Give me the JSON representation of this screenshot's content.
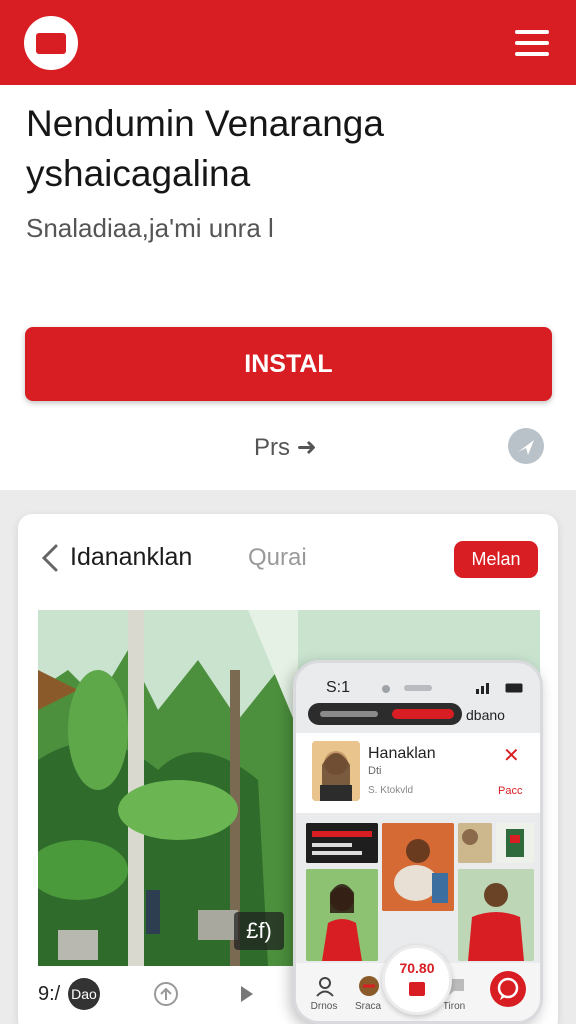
{
  "header": {
    "logo_icon": "brand-logo-icon",
    "menu_icon": "hamburger-menu-icon",
    "brand_color": "#d81e23"
  },
  "hero": {
    "title": "Nendumin Venaranga yshaicagalina",
    "subtitle": "Snaladiaa,ja'mi unra l",
    "install_label": "INSTAL",
    "link_label": "Prs ➜",
    "share_icon": "share-icon"
  },
  "card": {
    "title": "Idananklan",
    "tab": "Qurai",
    "badge": "Melan",
    "photo_label": "£f)",
    "bottom_left_text": "9:/",
    "bottom_circle_text": "Dao"
  },
  "phone": {
    "time": "S:1",
    "brand": "dbano",
    "name": "Hanaklan",
    "sub": "Dti",
    "sub2": "S. Ktokvld",
    "close": "✕",
    "link": "Pacc",
    "center_label": "70.80",
    "nav": [
      "Drnos",
      "Sraca",
      "Tiron"
    ]
  }
}
